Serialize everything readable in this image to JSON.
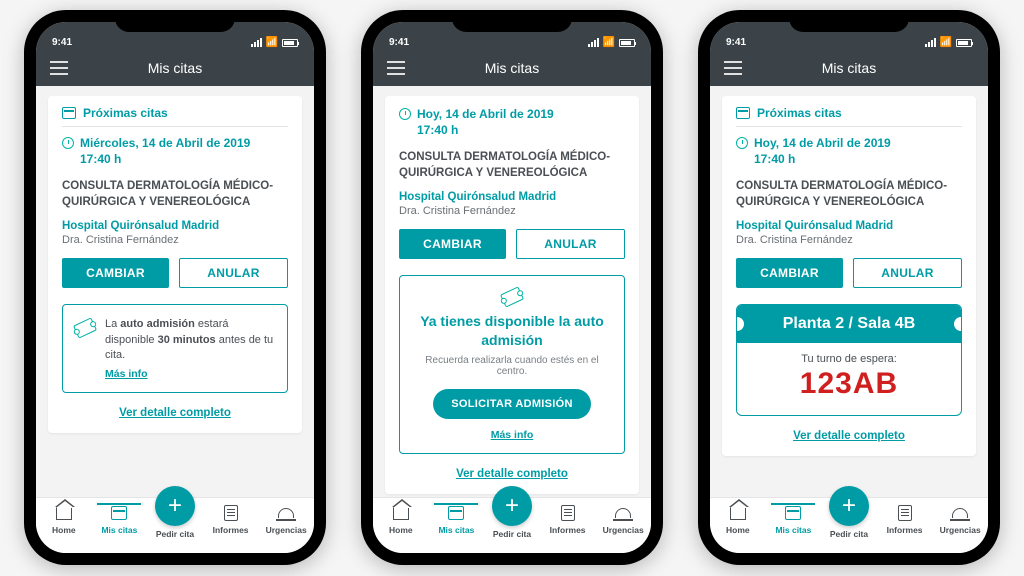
{
  "status": {
    "time": "9:41",
    "wifi": "wifi",
    "signal": "signal",
    "battery": "battery"
  },
  "header": {
    "title": "Mis citas"
  },
  "section": {
    "title": "Próximas citas"
  },
  "detail_link": "Ver detalle completo",
  "buttons": {
    "change": "CAMBIAR",
    "cancel": "ANULAR",
    "request_admission": "SOLICITAR ADMISIÓN",
    "more_info": "Más info"
  },
  "nav": {
    "home": "Home",
    "appointments": "Mis citas",
    "request": "Pedir cita",
    "reports": "Informes",
    "emergency": "Urgencias"
  },
  "screens": [
    {
      "date": "Miércoles, 14 de Abril de 2019",
      "time": "17:40 h",
      "subject": "CONSULTA DERMATOLOGÍA MÉDICO-QUIRÚRGICA Y VENEREOLÓGICA",
      "hospital": "Hospital Quirónsalud Madrid",
      "doctor": "Dra. Cristina Fernández",
      "auto_text_prefix": "La ",
      "auto_text_bold1": "auto admisión",
      "auto_text_mid": " estará disponible ",
      "auto_text_bold2": "30 minutos",
      "auto_text_suffix": " antes de tu cita."
    },
    {
      "date": "Hoy, 14 de Abril de 2019",
      "time": "17:40 h",
      "subject": "CONSULTA DERMATOLOGÍA MÉDICO-QUIRÚRGICA Y VENEREOLÓGICA",
      "hospital": "Hospital Quirónsalud Madrid",
      "doctor": "Dra. Cristina Fernández",
      "available_title_1": "Ya tienes disponible la auto",
      "available_title_2": "admisión",
      "available_sub": "Recuerda realizarla cuando estés en el centro."
    },
    {
      "date": "Hoy, 14 de Abril de 2019",
      "time": "17:40 h",
      "subject": "CONSULTA DERMATOLOGÍA MÉDICO-QUIRÚRGICA Y VENEREOLÓGICA",
      "hospital": "Hospital Quirónsalud Madrid",
      "doctor": "Dra. Cristina Fernández",
      "location": "Planta 2 / Sala 4B",
      "turn_label": "Tu turno de espera:",
      "turn_code": "123AB"
    }
  ]
}
